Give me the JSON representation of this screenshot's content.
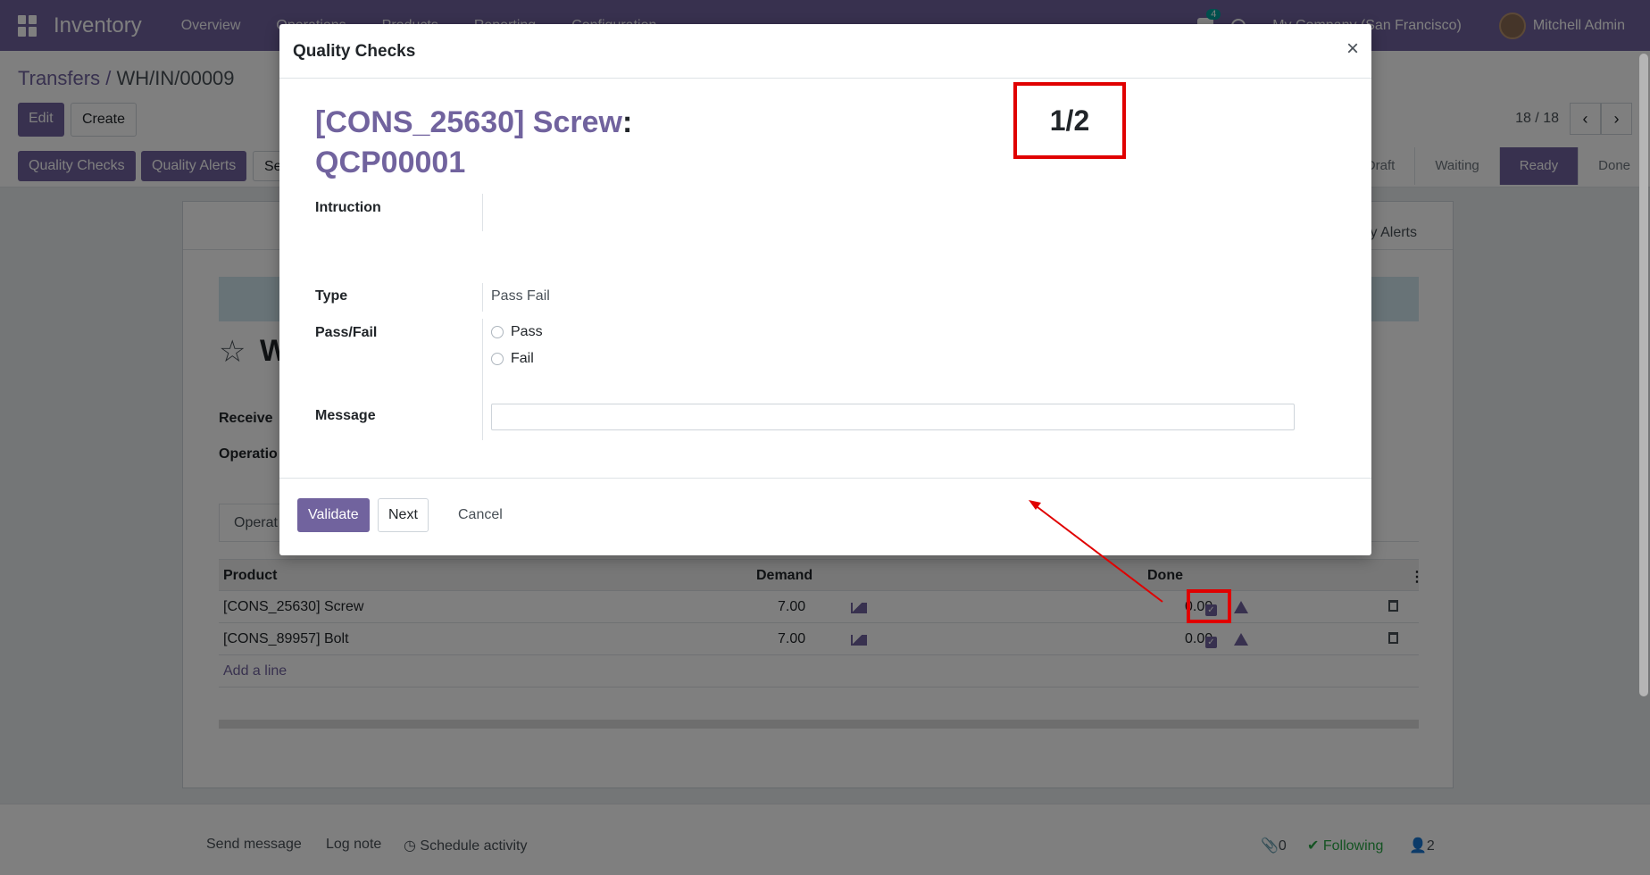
{
  "navbar": {
    "app_name": "Inventory",
    "menu": [
      "Overview",
      "Operations",
      "Products",
      "Reporting",
      "Configuration"
    ],
    "messages_count": "4",
    "company": "My Company (San Francisco)",
    "user": "Mitchell Admin"
  },
  "breadcrumb": {
    "parent": "Transfers",
    "separator": "/",
    "current": "WH/IN/00009"
  },
  "control": {
    "edit_label": "Edit",
    "create_label": "Create",
    "pager_value": "18 / 18"
  },
  "statusbar": {
    "buttons": [
      "Quality Checks",
      "Quality Alerts",
      "Se"
    ],
    "stages": [
      "Draft",
      "Waiting",
      "Ready",
      "Done"
    ],
    "active_stage": "Ready"
  },
  "sheet": {
    "smart_button": "ality Alerts",
    "title_fragment": "W",
    "labels": {
      "receive": "Receive",
      "operation": "Operatio"
    },
    "tab": "Operat",
    "table": {
      "headers": {
        "product": "Product",
        "demand": "Demand",
        "done": "Done"
      },
      "rows": [
        {
          "product": "[CONS_25630] Screw",
          "demand": "7.00",
          "done": "0.00"
        },
        {
          "product": "[CONS_89957] Bolt",
          "demand": "7.00",
          "done": "0.00"
        }
      ],
      "add_line": "Add a line"
    }
  },
  "chatter": {
    "send_message": "Send message",
    "log_note": "Log note",
    "schedule_activity": "Schedule activity",
    "attachments": "0",
    "following": "Following",
    "followers": "2"
  },
  "modal": {
    "title": "Quality Checks",
    "close": "×",
    "check_title_product": "[CONS_25630] Screw",
    "check_title_colon": ":",
    "check_title_code": "QCP00001",
    "counter": "1/2",
    "fields": {
      "instruction_label": "Intruction",
      "type_label": "Type",
      "type_value": "Pass Fail",
      "passfail_label": "Pass/Fail",
      "pass_option": "Pass",
      "fail_option": "Fail",
      "message_label": "Message",
      "message_value": ""
    },
    "footer": {
      "validate": "Validate",
      "next": "Next",
      "cancel": "Cancel"
    }
  },
  "colors": {
    "brand": "#71639e",
    "annotation": "#e00000"
  }
}
